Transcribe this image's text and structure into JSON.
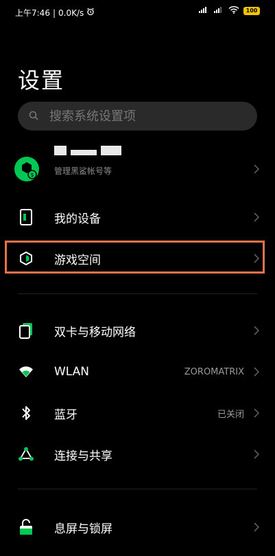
{
  "status_bar": {
    "time": "上午7:46",
    "net_speed": "0.0K/s",
    "battery": "100"
  },
  "page_title": "设置",
  "search": {
    "placeholder": "搜索系统设置项"
  },
  "account": {
    "subtitle": "管理黑鲨帐号等"
  },
  "items": [
    {
      "label": "我的设备",
      "icon": "phone-icon"
    },
    {
      "label": "游戏空间",
      "icon": "game-hexagon-icon",
      "highlighted": true
    },
    {
      "label": "双卡与移动网络",
      "icon": "sim-card-icon"
    },
    {
      "label": "WLAN",
      "icon": "wifi-icon",
      "value": "ZOROMATRIX"
    },
    {
      "label": "蓝牙",
      "icon": "bluetooth-icon",
      "value": "已关闭"
    },
    {
      "label": "连接与共享",
      "icon": "share-icon"
    },
    {
      "label": "息屏与锁屏",
      "icon": "lock-icon"
    }
  ],
  "colors": {
    "accent": "#00c853",
    "highlight_border": "#e8734a",
    "search_bg": "#2a2a2a"
  }
}
